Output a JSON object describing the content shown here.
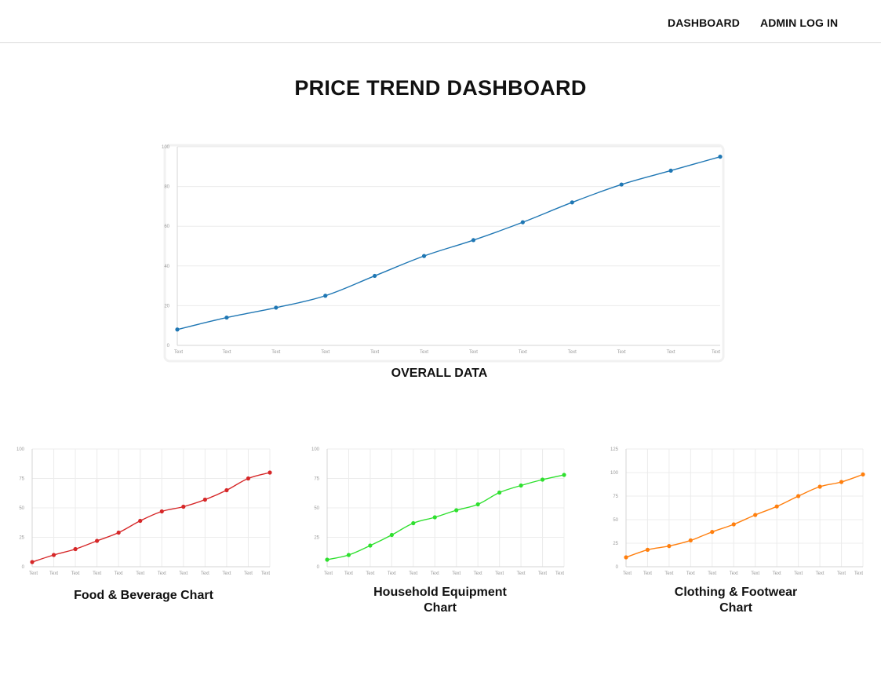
{
  "nav": {
    "dashboard_label": "DASHBOARD",
    "admin_label": "ADMIN LOG IN"
  },
  "page": {
    "title": "PRICE TREND DASHBOARD"
  },
  "charts": {
    "overall_caption": "OVERALL DATA",
    "food_caption": "Food & Beverage Chart",
    "household_caption": "Household Equipment Chart",
    "clothing_caption": "Clothing & Footwear Chart"
  },
  "chart_data": [
    {
      "type": "line",
      "id": "overall",
      "color": "#1f77b4",
      "categories": [
        "Text",
        "Text",
        "Text",
        "Text",
        "Text",
        "Text",
        "Text",
        "Text",
        "Text",
        "Text",
        "Text",
        "Text"
      ],
      "values": [
        8,
        14,
        19,
        25,
        35,
        45,
        53,
        62,
        72,
        81,
        88,
        95
      ],
      "ylim": [
        0,
        100
      ],
      "yticks": [
        0,
        20,
        40,
        60,
        80,
        100
      ],
      "grid": "horizontal",
      "title": "",
      "xlabel": "",
      "ylabel": ""
    },
    {
      "type": "line",
      "id": "food",
      "color": "#d62728",
      "categories": [
        "Text",
        "Text",
        "Text",
        "Text",
        "Text",
        "Text",
        "Text",
        "Text",
        "Text",
        "Text",
        "Text",
        "Text"
      ],
      "values": [
        4,
        10,
        15,
        22,
        29,
        39,
        47,
        51,
        57,
        65,
        75,
        80
      ],
      "ylim": [
        0,
        100
      ],
      "yticks": [
        0,
        25,
        50,
        75,
        100
      ],
      "grid": "both",
      "title": "",
      "xlabel": "",
      "ylabel": ""
    },
    {
      "type": "line",
      "id": "household",
      "color": "#2ee02e",
      "categories": [
        "Text",
        "Text",
        "Text",
        "Text",
        "Text",
        "Text",
        "Text",
        "Text",
        "Text",
        "Text",
        "Text",
        "Text"
      ],
      "values": [
        6,
        10,
        18,
        27,
        37,
        42,
        48,
        53,
        63,
        69,
        74,
        78
      ],
      "ylim": [
        0,
        100
      ],
      "yticks": [
        0,
        25,
        50,
        75,
        100
      ],
      "grid": "both",
      "title": "",
      "xlabel": "",
      "ylabel": ""
    },
    {
      "type": "line",
      "id": "clothing",
      "color": "#ff7f0e",
      "categories": [
        "Text",
        "Text",
        "Text",
        "Text",
        "Text",
        "Text",
        "Text",
        "Text",
        "Text",
        "Text",
        "Text",
        "Text"
      ],
      "values": [
        10,
        18,
        22,
        28,
        37,
        45,
        55,
        64,
        75,
        85,
        90,
        98
      ],
      "ylim": [
        0,
        125
      ],
      "yticks": [
        0,
        25,
        50,
        75,
        100,
        125
      ],
      "grid": "both",
      "title": "",
      "xlabel": "",
      "ylabel": ""
    }
  ]
}
